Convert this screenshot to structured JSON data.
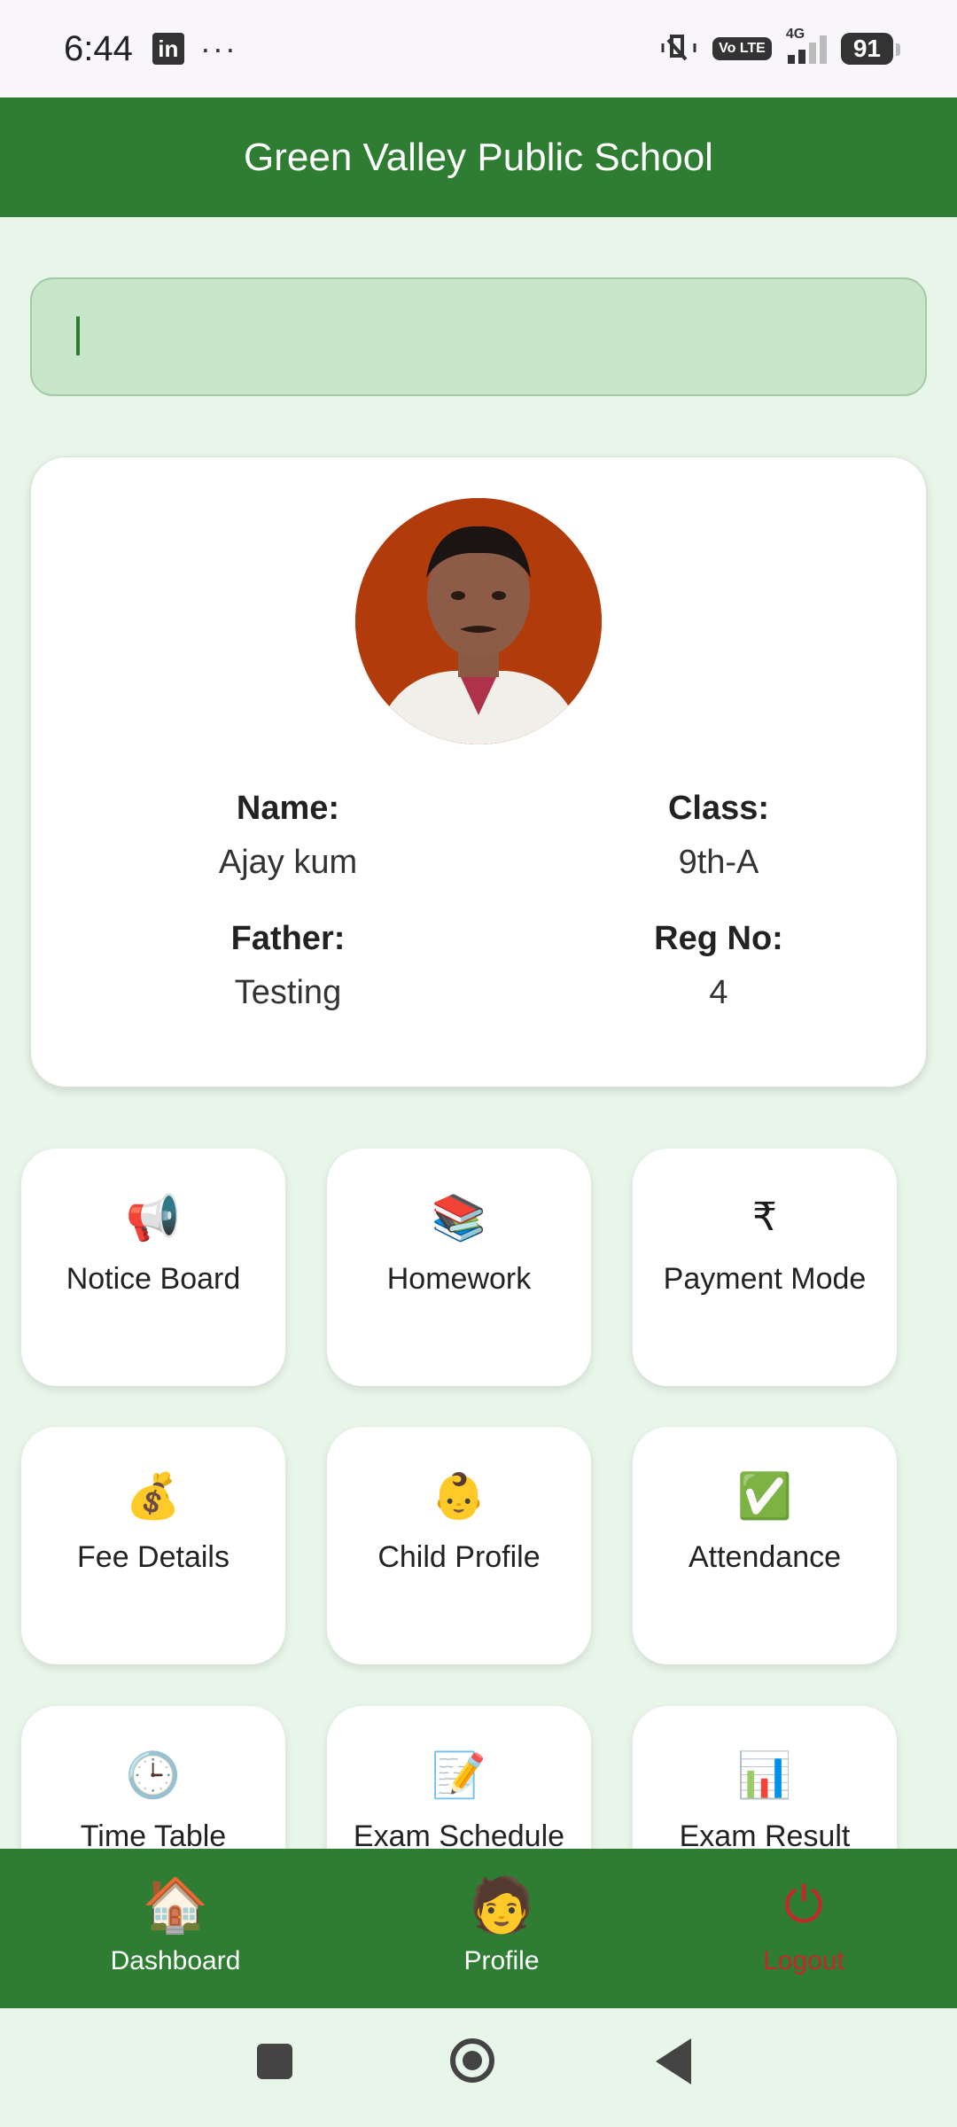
{
  "status_bar": {
    "time": "6:44",
    "linkedin_icon_text": "in",
    "more_dots": "···",
    "volte": "Vo LTE",
    "network": "4G",
    "battery": "91"
  },
  "header": {
    "title": "Green Valley Public School"
  },
  "search": {
    "value": ""
  },
  "profile": {
    "name_label": "Name:",
    "name_value": "Ajay kum",
    "class_label": "Class:",
    "class_value": "9th-A",
    "father_label": "Father:",
    "father_value": "Testing",
    "reg_label": "Reg No:",
    "reg_value": "4"
  },
  "tiles": [
    {
      "label": "Notice Board",
      "icon": "📢",
      "icon_name": "megaphone-icon"
    },
    {
      "label": "Homework",
      "icon": "📚",
      "icon_name": "books-icon"
    },
    {
      "label": "Payment Mode",
      "icon": "₹",
      "icon_name": "rupee-icon"
    },
    {
      "label": "Fee Details",
      "icon": "💰",
      "icon_name": "money-bag-icon"
    },
    {
      "label": "Child Profile",
      "icon": "👶",
      "icon_name": "baby-icon"
    },
    {
      "label": "Attendance",
      "icon": "✅",
      "icon_name": "check-mark-icon"
    },
    {
      "label": "Time Table",
      "icon": "🕒",
      "icon_name": "clock-icon"
    },
    {
      "label": "Exam Schedule",
      "icon": "📝",
      "icon_name": "memo-icon"
    },
    {
      "label": "Exam Result",
      "icon": "📊",
      "icon_name": "bar-chart-icon"
    }
  ],
  "bottom_nav": [
    {
      "label": "Dashboard",
      "icon": "🏠",
      "icon_name": "home-icon"
    },
    {
      "label": "Profile",
      "icon": "🧑",
      "icon_name": "person-icon"
    },
    {
      "label": "Logout",
      "icon": "⏻",
      "icon_name": "power-icon"
    }
  ],
  "colors": {
    "primary": "#2e7d32",
    "background": "#e8f5e9",
    "search_bg": "#c8e6c9",
    "logout": "#c62828"
  }
}
